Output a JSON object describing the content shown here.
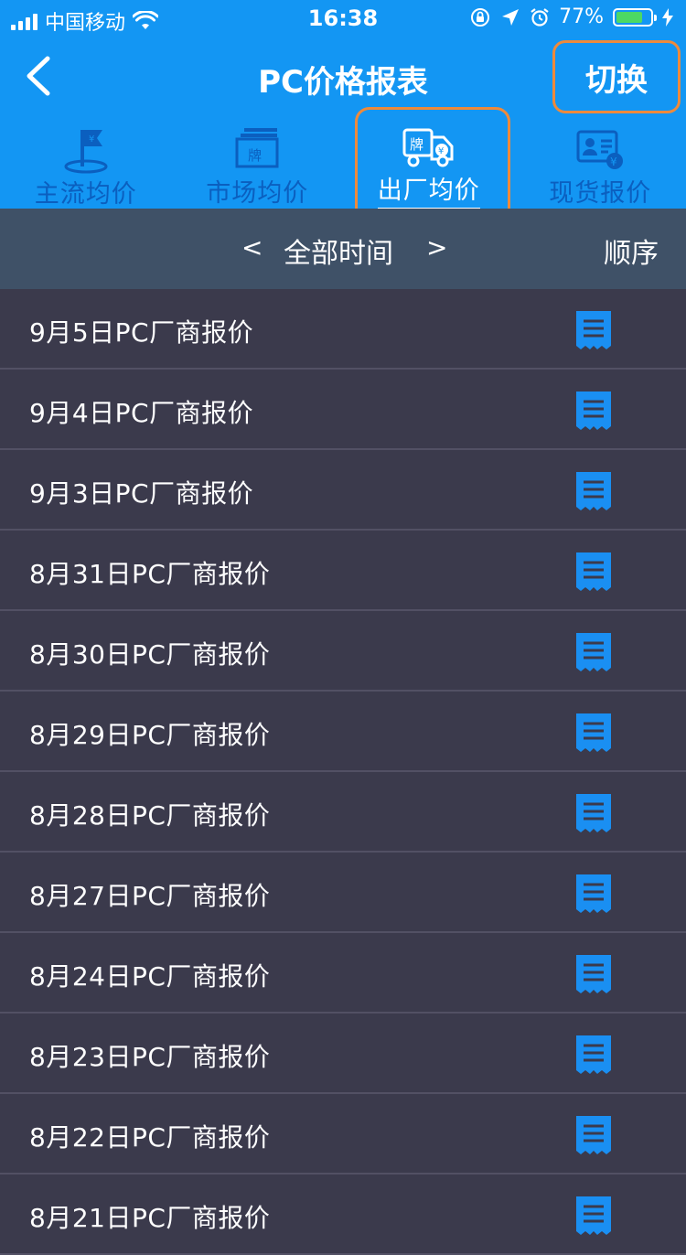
{
  "status_bar": {
    "carrier": "中国移动",
    "time": "16:38",
    "battery": "77%",
    "battery_level": 0.77
  },
  "nav": {
    "title": "PC价格报表",
    "switch_label": "切换",
    "back_icon": "chevron-left-icon"
  },
  "tabs": [
    {
      "label": "主流均价",
      "icon": "flag-yuan-icon",
      "active": false
    },
    {
      "label": "市场均价",
      "icon": "brand-board-icon",
      "active": false
    },
    {
      "label": "出厂均价",
      "icon": "delivery-truck-icon",
      "active": true
    },
    {
      "label": "现货报价",
      "icon": "id-card-yuan-icon",
      "active": false
    }
  ],
  "filter": {
    "prev": "<",
    "range_label": "全部时间",
    "next": ">",
    "order_label": "顺序"
  },
  "reports": [
    {
      "label": "9月5日PC厂商报价"
    },
    {
      "label": "9月4日PC厂商报价"
    },
    {
      "label": "9月3日PC厂商报价"
    },
    {
      "label": "8月31日PC厂商报价"
    },
    {
      "label": "8月30日PC厂商报价"
    },
    {
      "label": "8月29日PC厂商报价"
    },
    {
      "label": "8月28日PC厂商报价"
    },
    {
      "label": "8月27日PC厂商报价"
    },
    {
      "label": "8月24日PC厂商报价"
    },
    {
      "label": "8月23日PC厂商报价"
    },
    {
      "label": "8月22日PC厂商报价"
    },
    {
      "label": "8月21日PC厂商报价"
    }
  ],
  "colors": {
    "header_blue": "#1396f3",
    "inactive_tab": "#0b5fbf",
    "highlight_orange": "#ee8a3b",
    "filter_bg": "#3f5167",
    "list_bg": "#3b3a4c",
    "doc_icon": "#1a8ff2"
  }
}
